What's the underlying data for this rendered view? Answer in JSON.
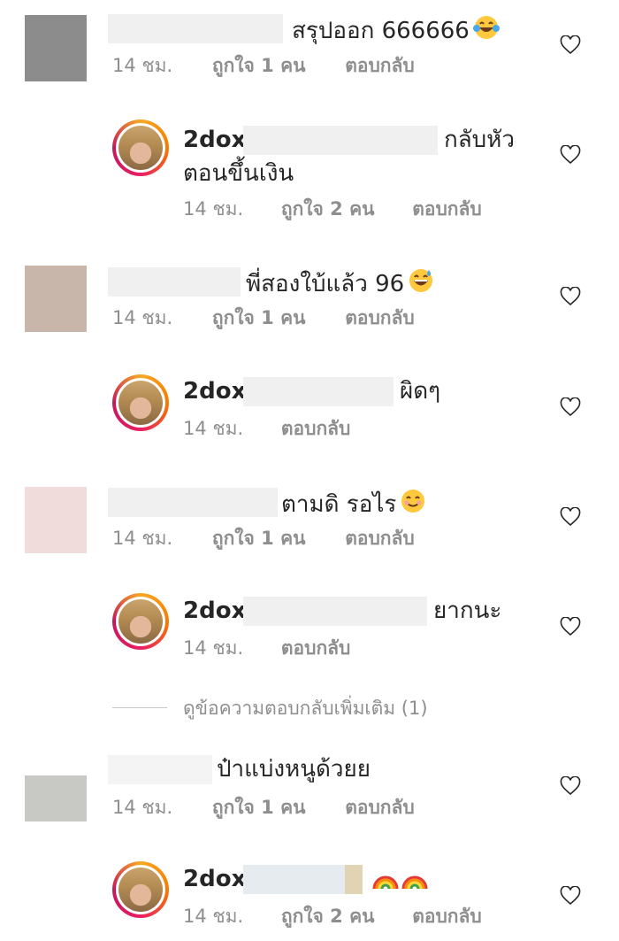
{
  "comments": [
    {
      "text": "สรุปออก 666666",
      "time": "14 ชม.",
      "likes": "ถูกใจ 1 คน",
      "reply": "ตอบกลับ",
      "emoji": "tears-of-joy"
    },
    {
      "username": "2dox",
      "text": "กลับหัว",
      "text2": "ตอนขึ้นเงิน",
      "time": "14 ชม.",
      "likes": "ถูกใจ 2 คน",
      "reply": "ตอบกลับ"
    },
    {
      "text": "พี่สองใบ้แล้ว 96",
      "time": "14 ชม.",
      "likes": "ถูกใจ 1 คน",
      "reply": "ตอบกลับ",
      "emoji": "grinning-sweat"
    },
    {
      "username": "2dox",
      "text": "ผิดๆ",
      "time": "14 ชม.",
      "reply": "ตอบกลับ"
    },
    {
      "text": "ตามดิ รอไร",
      "time": "14 ชม.",
      "likes": "ถูกใจ 1 คน",
      "reply": "ตอบกลับ",
      "emoji": "smiling-eyes"
    },
    {
      "username": "2dox",
      "text": "ยากนะ",
      "time": "14 ชม.",
      "reply": "ตอบกลับ"
    },
    {
      "text": "ป๋าแบ่งหนูด้วยย",
      "time": "14 ชม.",
      "likes": "ถูกใจ 1 คน",
      "reply": "ตอบกลับ"
    },
    {
      "username": "2dox",
      "text": "",
      "time": "14 ชม.",
      "likes": "ถูกใจ 2 คน",
      "reply": "ตอบกลับ",
      "emoji": "rainbow x2"
    }
  ],
  "view_more_replies": "ดูข้อความตอบกลับเพิ่มเติม (1)",
  "colors": {
    "text": "#262626",
    "meta": "#8e8e8e",
    "ring": "#e91e63"
  }
}
